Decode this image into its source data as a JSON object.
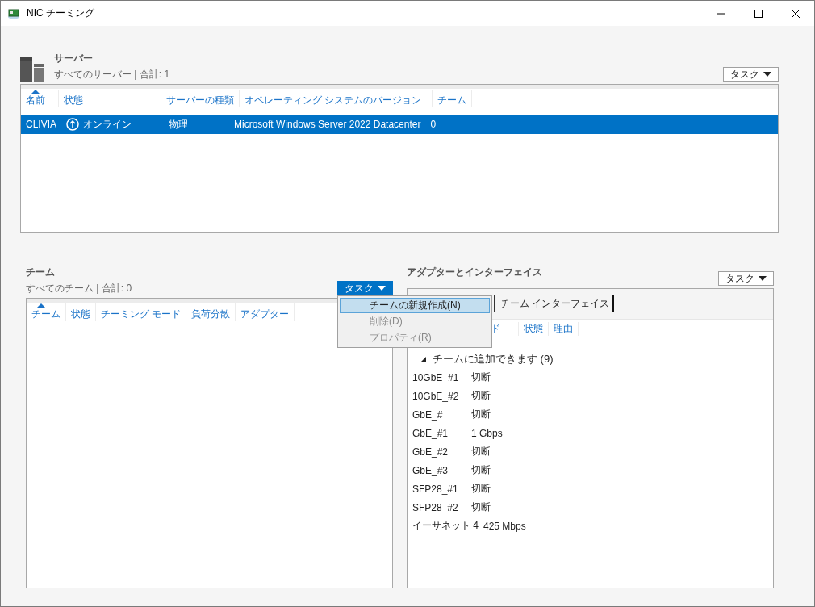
{
  "window": {
    "title": "NIC チーミング"
  },
  "servers": {
    "title": "サーバー",
    "subtitle": "すべてのサーバー | 合計: 1",
    "tasks_button": {
      "label": "タスク",
      "active": false
    },
    "columns": [
      {
        "label": "名前",
        "sorted": true
      },
      {
        "label": "状態",
        "sorted": false
      },
      {
        "label": "サーバーの種類",
        "sorted": false
      },
      {
        "label": "オペレーティング システムのバージョン",
        "sorted": false
      },
      {
        "label": "チーム",
        "sorted": false
      }
    ],
    "rows": [
      {
        "name": "CLIVIA",
        "status": "オンライン",
        "type": "物理",
        "os": "Microsoft Windows Server 2022 Datacenter",
        "teams": "0",
        "selected": true
      }
    ]
  },
  "teams": {
    "title": "チーム",
    "subtitle": "すべてのチーム | 合計: 0",
    "tasks_button": {
      "label": "タスク",
      "active": true
    },
    "menu": [
      {
        "label": "チームの新規作成(N)",
        "selected": true,
        "disabled": false
      },
      {
        "label": "削除(D)",
        "selected": false,
        "disabled": true
      },
      {
        "label": "プロパティ(R)",
        "selected": false,
        "disabled": true
      }
    ],
    "columns": [
      {
        "label": "チーム",
        "sorted": true
      },
      {
        "label": "状態",
        "sorted": false
      },
      {
        "label": "チーミング モード",
        "sorted": false
      },
      {
        "label": "負荷分散",
        "sorted": false
      },
      {
        "label": "アダプター",
        "sorted": false
      }
    ]
  },
  "adapters": {
    "title": "アダプターとインターフェイス",
    "tasks_button": {
      "label": "タスク",
      "active": false
    },
    "tabs": [
      {
        "label": "チーム インターフェイス",
        "selected": false
      }
    ],
    "columns": [
      "ド",
      "状態",
      "理由"
    ],
    "group": {
      "label": "チームに追加できます (9)",
      "expanded": true
    },
    "rows": [
      {
        "name": "10GbE_#1",
        "speed": "切断"
      },
      {
        "name": "10GbE_#2",
        "speed": "切断"
      },
      {
        "name": "GbE_#",
        "speed": "切断"
      },
      {
        "name": "GbE_#1",
        "speed": "1 Gbps"
      },
      {
        "name": "GbE_#2",
        "speed": "切断"
      },
      {
        "name": "GbE_#3",
        "speed": "切断"
      },
      {
        "name": "SFP28_#1",
        "speed": "切断"
      },
      {
        "name": "SFP28_#2",
        "speed": "切断"
      },
      {
        "name": "イーサネット 4",
        "speed": "425 Mbps"
      }
    ]
  }
}
